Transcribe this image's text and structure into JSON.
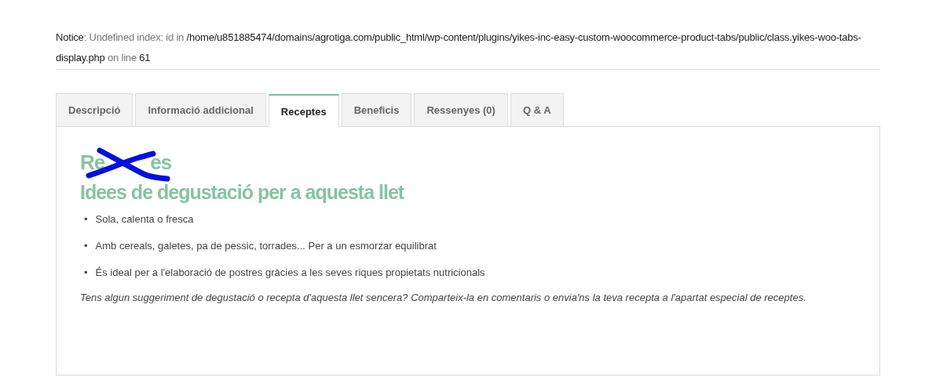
{
  "notice": "**Notice**: Undefined index: id in **/home/u851885474/domains/agrotiga.com/public_html/wp-content/plugins/yikes-inc-easy-custom-woocommerce-product-tabs/public/class.yikes-woo-tabs-display.php** on line **61**",
  "tabs": [
    {
      "label": "Descripció",
      "selected": false
    },
    {
      "label": "Informació addicional",
      "selected": false
    },
    {
      "label": "Receptes",
      "selected": true
    },
    {
      "label": "Beneficis",
      "selected": false
    },
    {
      "label": "Ressenyes (0)",
      "selected": false
    },
    {
      "label": "Q & A",
      "selected": false
    }
  ],
  "panel": {
    "heading": [
      {
        "text": "Re"
      },
      {
        "text": "es"
      }
    ],
    "subheading": "Idees de degustació per a aquesta llet",
    "items": [
      {
        "bullet": "•",
        "text": "Sola, calenta o fresca"
      },
      {
        "bullet": "•",
        "text": "Amb cereals, galetes, pa de pessic, torrades... Per a un esmorzar equilibrat"
      },
      {
        "bullet": "•",
        "text": "És ideal per a l'elaboració de postres gràcies a les seves riques propietats nutricionals"
      }
    ],
    "note": "Tens algun suggeriment de degustació o recepta d'aquesta llet sencera? Comparteix-la en comentaris o envia'ns la teva recepta a l'apartat especial de receptes."
  }
}
